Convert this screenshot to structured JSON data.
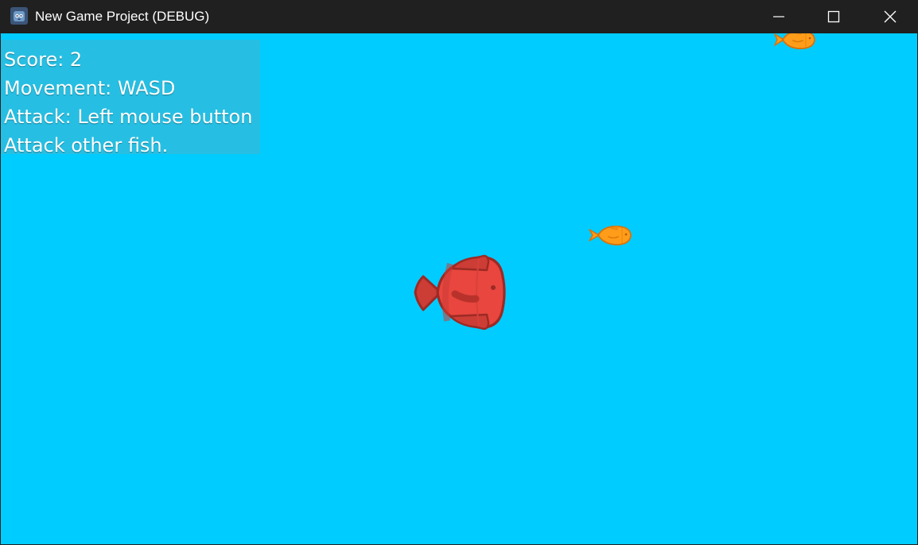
{
  "window": {
    "title": "New Game Project (DEBUG)",
    "app_icon": "godot-icon",
    "controls": {
      "minimize": "minimize-icon",
      "maximize": "maximize-icon",
      "close": "close-icon"
    }
  },
  "game": {
    "background_color": "#00ccff",
    "hud": {
      "score_line": "Score: 2",
      "movement_line": "Movement: WASD",
      "attack_line": "Attack: Left mouse button",
      "goal_line": "Attack other fish."
    },
    "player_fish": {
      "color": "#e8463e",
      "outline": "#9c2a25"
    },
    "enemy_fish": {
      "color": "#ff9d1a",
      "outline": "#d9730a"
    }
  }
}
